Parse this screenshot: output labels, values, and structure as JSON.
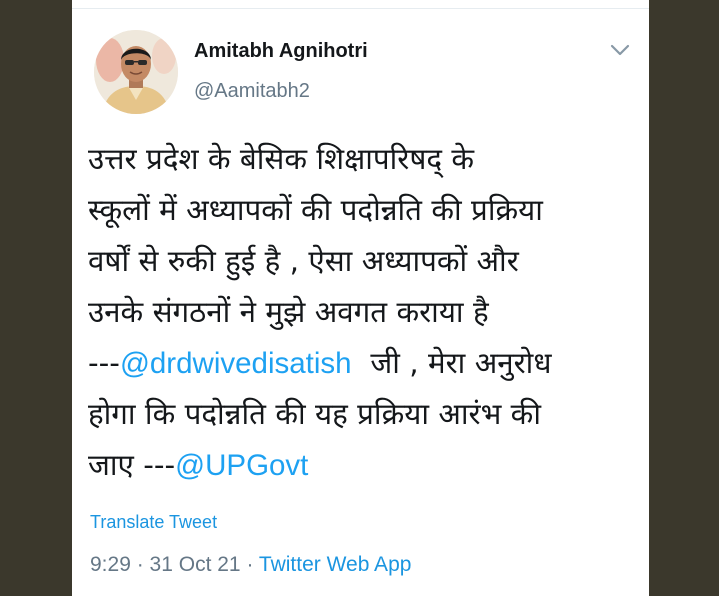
{
  "user": {
    "name": "Amitabh Agnihotri",
    "handle": "@Aamitabh2"
  },
  "tweet": {
    "lines": [
      {
        "text": "उत्तर प्रदेश के बेसिक शिक्षापरिषद् के"
      },
      {
        "text": "स्कूलों में अध्यापकों की पदोन्नति की प्रक्रिया"
      },
      {
        "text": "वर्षों से रुकी हुई है , ऐसा अध्यापकों और"
      },
      {
        "text": "उनके संगठनों ने मुझे अवगत कराया है"
      },
      {
        "prefix": "---",
        "mention": "@drdwivedisatish",
        "suffix": "  जी , मेरा अनुरोध"
      },
      {
        "text": "होगा कि पदोन्नति की यह प्रक्रिया आरंभ की"
      },
      {
        "prefix": "जाए ---",
        "mention": "@UPGovt"
      }
    ]
  },
  "translate_label": "Translate Tweet",
  "meta": {
    "time": "9:29",
    "separator": " · ",
    "date": "31 Oct 21",
    "source": "Twitter Web App"
  },
  "icons": {
    "menu": "chevron-down-icon",
    "avatar": "profile-photo"
  },
  "colors": {
    "link": "#1da1f2",
    "text": "#14171a",
    "muted": "#657786",
    "background": "#3b382c"
  }
}
